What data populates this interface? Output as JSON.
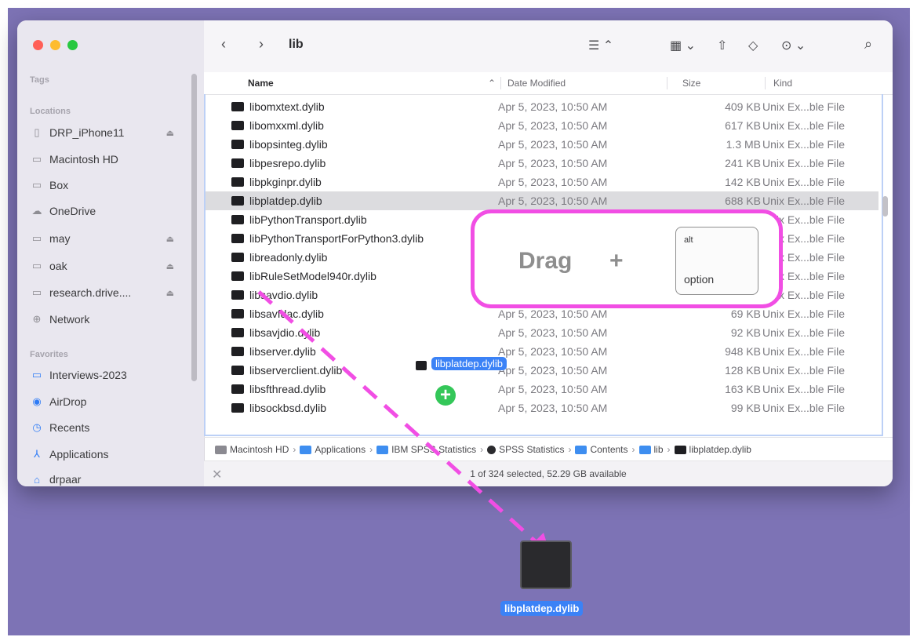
{
  "window": {
    "title": "lib",
    "toolbar_icons": [
      "back-icon",
      "forward-icon",
      "list-view-icon",
      "group-icon",
      "share-icon",
      "tag-icon",
      "more-icon",
      "search-icon"
    ]
  },
  "sidebar": {
    "tags_heading": "Tags",
    "locations_heading": "Locations",
    "favorites_heading": "Favorites",
    "locations": [
      {
        "label": "DRP_iPhone11",
        "icon": "phone-icon",
        "eject": "⏏"
      },
      {
        "label": "Macintosh HD",
        "icon": "drive-icon"
      },
      {
        "label": "Box",
        "icon": "box-icon"
      },
      {
        "label": "OneDrive",
        "icon": "cloud-icon"
      },
      {
        "label": "may",
        "icon": "display-icon",
        "eject": "⏏"
      },
      {
        "label": "oak",
        "icon": "display-icon",
        "eject": "⏏"
      },
      {
        "label": "research.drive....",
        "icon": "display-icon",
        "eject": "⏏"
      },
      {
        "label": "Network",
        "icon": "network-icon"
      }
    ],
    "favorites": [
      {
        "label": "Interviews-2023",
        "icon": "folder-icon"
      },
      {
        "label": "AirDrop",
        "icon": "airdrop-icon"
      },
      {
        "label": "Recents",
        "icon": "clock-icon"
      },
      {
        "label": "Applications",
        "icon": "applications-icon"
      },
      {
        "label": "drpaar",
        "icon": "home-icon"
      }
    ]
  },
  "columns": {
    "name": "Name",
    "date": "Date Modified",
    "size": "Size",
    "kind": "Kind"
  },
  "files": [
    {
      "name": "libomxtext.dylib",
      "date": "Apr 5, 2023, 10:50 AM",
      "size": "409 KB",
      "kind": "Unix Ex...ble File"
    },
    {
      "name": "libomxxml.dylib",
      "date": "Apr 5, 2023, 10:50 AM",
      "size": "617 KB",
      "kind": "Unix Ex...ble File"
    },
    {
      "name": "libopsinteg.dylib",
      "date": "Apr 5, 2023, 10:50 AM",
      "size": "1.3 MB",
      "kind": "Unix Ex...ble File"
    },
    {
      "name": "libpesrepo.dylib",
      "date": "Apr 5, 2023, 10:50 AM",
      "size": "241 KB",
      "kind": "Unix Ex...ble File"
    },
    {
      "name": "libpkginpr.dylib",
      "date": "Apr 5, 2023, 10:50 AM",
      "size": "142 KB",
      "kind": "Unix Ex...ble File"
    },
    {
      "name": "libplatdep.dylib",
      "date": "Apr 5, 2023, 10:50 AM",
      "size": "688 KB",
      "kind": "Unix Ex...ble File",
      "selected": true
    },
    {
      "name": "libPythonTransport.dylib",
      "date": "",
      "size": "",
      "kind": "Unix Ex...ble File"
    },
    {
      "name": "libPythonTransportForPython3.dylib",
      "date": "",
      "size": "",
      "kind": "Unix Ex...ble File"
    },
    {
      "name": "libreadonly.dylib",
      "date": "",
      "size": "",
      "kind": "Unix Ex...ble File"
    },
    {
      "name": "libRuleSetModel940r.dylib",
      "date": "",
      "size": "",
      "kind": "Unix Ex...ble File"
    },
    {
      "name": "libsavdio.dylib",
      "date": "",
      "size": "",
      "kind": "Unix Ex...ble File"
    },
    {
      "name": "libsavfdac.dylib",
      "date": "Apr 5, 2023, 10:50 AM",
      "size": "69 KB",
      "kind": "Unix Ex...ble File"
    },
    {
      "name": "libsavjdio.dylib",
      "date": "Apr 5, 2023, 10:50 AM",
      "size": "92 KB",
      "kind": "Unix Ex...ble File"
    },
    {
      "name": "libserver.dylib",
      "date": "Apr 5, 2023, 10:50 AM",
      "size": "948 KB",
      "kind": "Unix Ex...ble File"
    },
    {
      "name": "libserverclient.dylib",
      "date": "Apr 5, 2023, 10:50 AM",
      "size": "128 KB",
      "kind": "Unix Ex...ble File"
    },
    {
      "name": "libsfthread.dylib",
      "date": "Apr 5, 2023, 10:50 AM",
      "size": "163 KB",
      "kind": "Unix Ex...ble File"
    },
    {
      "name": "libsockbsd.dylib",
      "date": "Apr 5, 2023, 10:50 AM",
      "size": "99 KB",
      "kind": "Unix Ex...ble File"
    }
  ],
  "pathbar": [
    "Macintosh HD",
    "Applications",
    "IBM SPSS Statistics",
    "SPSS Statistics",
    "Contents",
    "lib",
    "libplatdep.dylib"
  ],
  "status": {
    "text": "1 of 324 selected, 52.29 GB available"
  },
  "overlay": {
    "drag_label": "Drag",
    "plus_label": "+",
    "key_top": "alt",
    "key_bottom": "option",
    "ghost_label": "libplatdep.dylib",
    "badge": "+",
    "desktop_file": "libplatdep.dylib"
  },
  "colors": {
    "callout_border": "#f14ee4",
    "desktop": "#7d73b5",
    "selection_label": "#3b82f6",
    "copy_badge": "#34c759"
  }
}
